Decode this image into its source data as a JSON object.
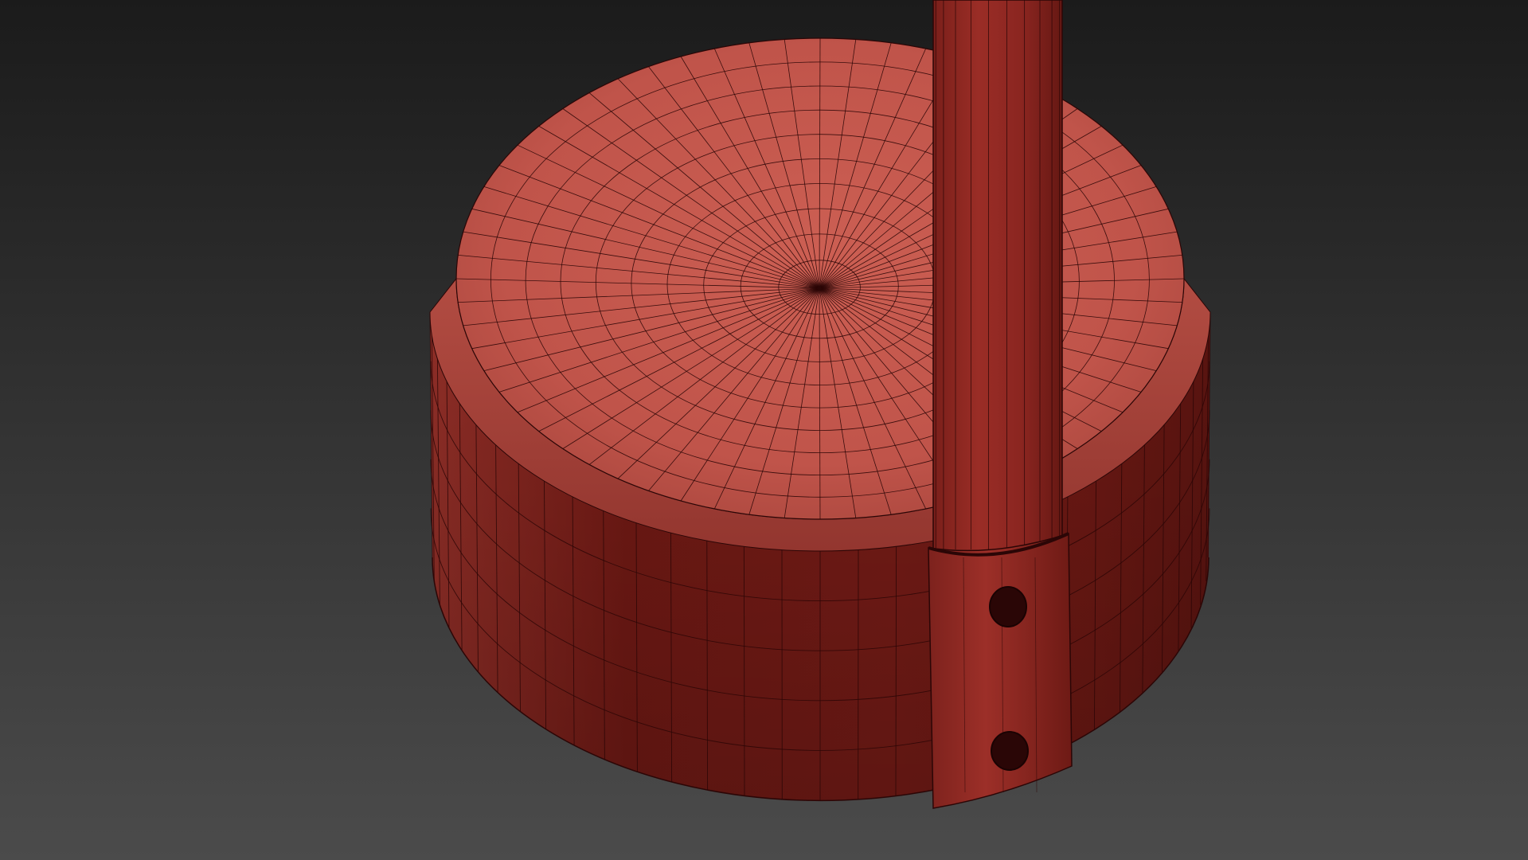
{
  "viewport": {
    "background_top_color": "#1b1b1b",
    "background_bottom_color": "#4b4b4b",
    "wire_color": "#2b0606"
  },
  "model": {
    "base_cylinder": {
      "top_color": "#c2554a",
      "top_center_color": "#ca5c50",
      "side_color": "#7a1c17",
      "side_dark_color": "#5a1410",
      "bevel_color": "#a8443b",
      "radial_segments": 64,
      "top_rings": 9,
      "side_rows": 4
    },
    "pole": {
      "color": "#8a2520",
      "dark_color": "#5c1612",
      "flutes": 11
    },
    "bracket": {
      "color": "#8d2822",
      "hole_color": "#2a0606",
      "holes": 2
    }
  }
}
